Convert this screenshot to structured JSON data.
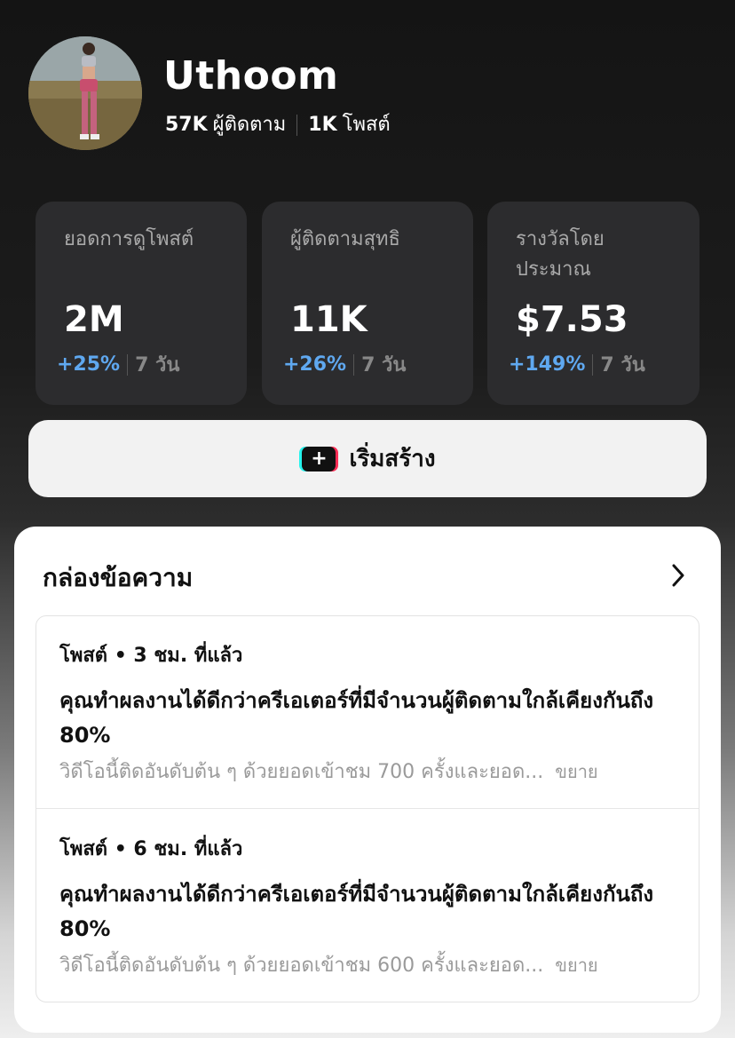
{
  "profile": {
    "username": "Uthoom",
    "followers_count": "57K",
    "followers_label": "ผู้ติดตาม",
    "posts_count": "1K",
    "posts_label": "โพสต์"
  },
  "stats": [
    {
      "label": "ยอดการดูโพสต์",
      "value": "2M",
      "change": "+25%",
      "period": "7 วัน"
    },
    {
      "label": "ผู้ติดตามสุทธิ",
      "value": "11K",
      "change": "+26%",
      "period": "7 วัน"
    },
    {
      "label": "รางวัลโดยประมาณ",
      "value": "$7.53",
      "change": "+149%",
      "period": "7 วัน"
    }
  ],
  "create_button": {
    "label": "เริ่มสร้าง",
    "icon": "plus-icon"
  },
  "inbox": {
    "title": "กล่องข้อความ",
    "icon": "chevron-right-icon",
    "messages": [
      {
        "meta": "โพสต์ • 3 ชม. ที่แล้ว",
        "headline": "คุณทำผลงานได้ดีกว่าครีเอเตอร์ที่มีจำนวนผู้ติดตามใกล้เคียงกันถึง 80%",
        "preview": "วิดีโอนี้ติดอันดับต้น ๆ ด้วยยอดเข้าชม 700 ครั้งและยอด...",
        "more": "ขยาย"
      },
      {
        "meta": "โพสต์ • 6 ชม. ที่แล้ว",
        "headline": "คุณทำผลงานได้ดีกว่าครีเอเตอร์ที่มีจำนวนผู้ติดตามใกล้เคียงกันถึง 80%",
        "preview": "วิดีโอนี้ติดอันดับต้น ๆ ด้วยยอดเข้าชม 600 ครั้งและยอด...",
        "more": "ขยาย"
      }
    ]
  },
  "colors": {
    "accent_blue": "#5fa8f0",
    "card_bg": "#2c2c2e"
  }
}
